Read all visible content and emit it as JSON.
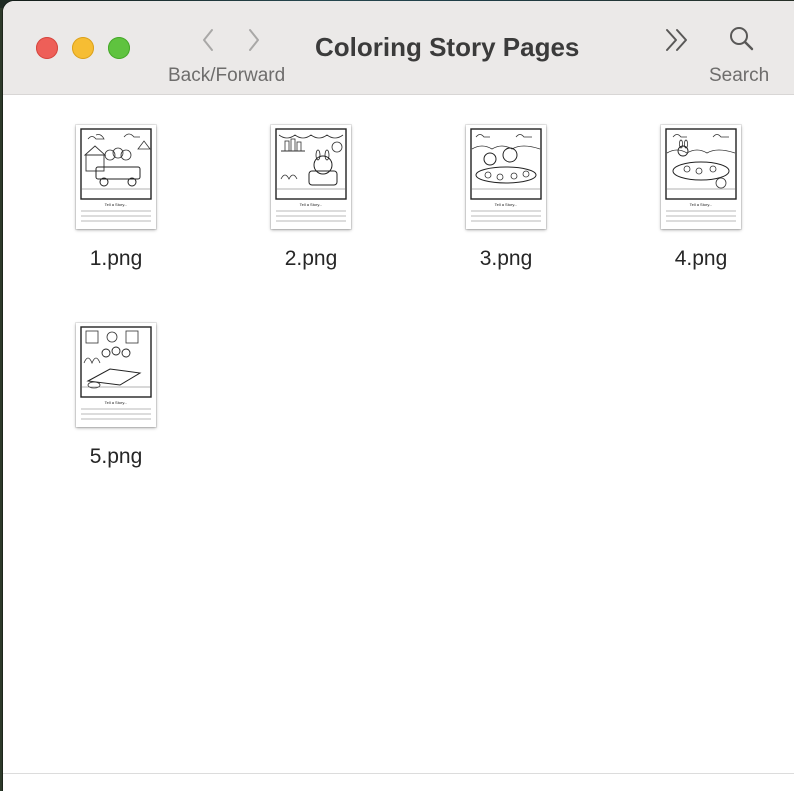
{
  "window": {
    "title": "Coloring Story Pages"
  },
  "toolbar": {
    "nav_label": "Back/Forward",
    "search_label": "Search"
  },
  "files": [
    {
      "name": "1.png"
    },
    {
      "name": "2.png"
    },
    {
      "name": "3.png"
    },
    {
      "name": "4.png"
    },
    {
      "name": "5.png"
    }
  ],
  "colors": {
    "close": "#ee5f58",
    "minimize": "#f6bd33",
    "maximize": "#5fc33f",
    "toolbar_bg": "#ebe9e8"
  },
  "icons": [
    "chevron-left-icon",
    "chevron-right-icon",
    "double-chevron-icon",
    "magnifier-icon"
  ]
}
